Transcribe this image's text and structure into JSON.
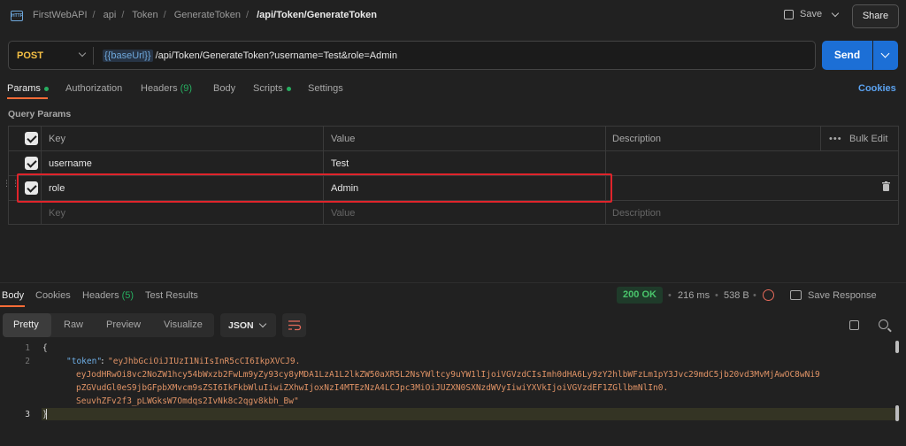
{
  "header": {
    "breadcrumbs": [
      "FirstWebAPI",
      "api",
      "Token",
      "GenerateToken"
    ],
    "current": "/api/Token/GenerateToken",
    "save_label": "Save",
    "share_label": "Share"
  },
  "request": {
    "method": "POST",
    "url_variable": "{{baseUrl}}",
    "url_path": "/api/Token/GenerateToken?username=Test&role=Admin",
    "send_label": "Send"
  },
  "tabs": {
    "params": "Params",
    "authorization": "Authorization",
    "headers": "Headers",
    "headers_count": "(9)",
    "body": "Body",
    "scripts": "Scripts",
    "settings": "Settings",
    "cookies": "Cookies"
  },
  "query_params": {
    "title": "Query Params",
    "columns": {
      "key": "Key",
      "value": "Value",
      "description": "Description",
      "bulk_edit": "Bulk Edit"
    },
    "rows": [
      {
        "key": "username",
        "value": "Test"
      },
      {
        "key": "role",
        "value": "Admin"
      }
    ],
    "placeholders": {
      "key": "Key",
      "value": "Value",
      "description": "Description"
    }
  },
  "response": {
    "tabs": {
      "body": "Body",
      "cookies": "Cookies",
      "headers": "Headers",
      "headers_count": "(5)",
      "test_results": "Test Results"
    },
    "status": "200 OK",
    "time": "216 ms",
    "size": "538 B",
    "save_response": "Save Response",
    "view_modes": [
      "Pretty",
      "Raw",
      "Preview",
      "Visualize"
    ],
    "format": "JSON",
    "code": {
      "line_numbers": [
        "1",
        "2",
        "3"
      ],
      "open_brace": "{",
      "close_brace": "}",
      "key": "\"token\"",
      "value_lines": [
        "\"eyJhbGciOiJIUzI1NiIsInR5cCI6IkpXVCJ9.",
        "eyJodHRwOi8vc2NoZW1hcy54bWxzb2FwLm9yZy93cy8yMDA1LzA1L2lkZW50aXR5L2NsYWltcy9uYW1lIjoiVGVzdCIsImh0dHA6Ly9zY2hlbWFzLm1pY3Jvc29mdC5jb20vd3MvMjAwOC8wNi9",
        "pZGVudGl0eS9jbGFpbXMvcm9sZSI6IkFkbWluIiwiZXhwIjoxNzI4MTEzNzA4LCJpc3MiOiJUZXN0SXNzdWVyIiwiYXVkIjoiVGVzdEF1ZGllbmNlIn0.",
        "SeuvhZFv2f3_pLWGksW7Omdqs2IvNk8c2qgv8kbh_Bw\""
      ]
    }
  }
}
